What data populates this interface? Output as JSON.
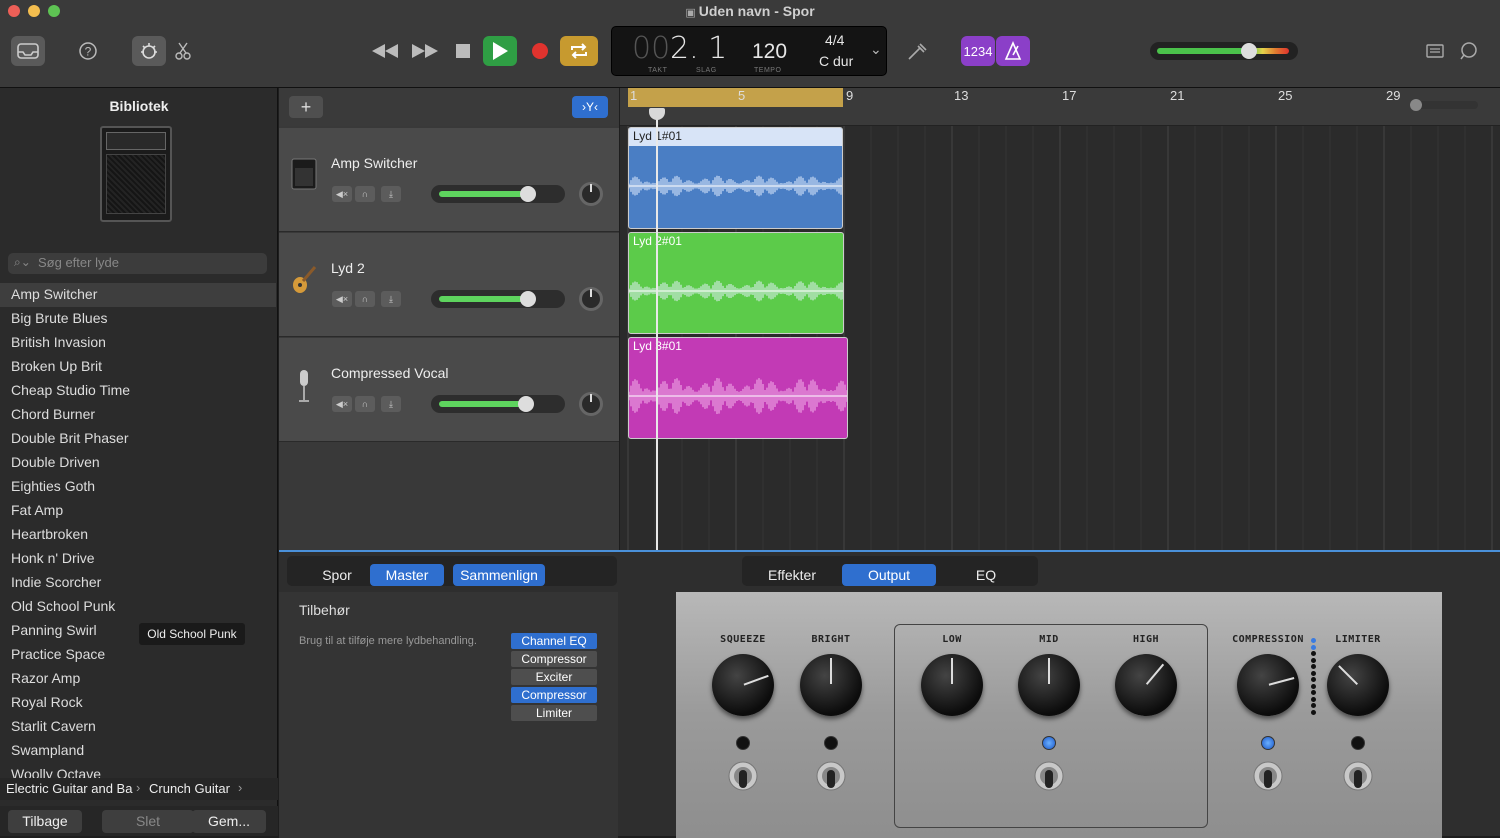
{
  "window": {
    "title": "Uden navn - Spor"
  },
  "lcd": {
    "bar_prefix": "00",
    "position": "2. 1",
    "takt_label": "TAKT",
    "slag_label": "SLAG",
    "tempo": "120",
    "tempo_label": "TEMPO",
    "signature": "4/4",
    "key": "C dur"
  },
  "count_in": "1234",
  "library": {
    "title": "Bibliotek",
    "search_placeholder": "Søg efter lyde",
    "items": [
      "Amp Switcher",
      "Big Brute Blues",
      "British Invasion",
      "Broken Up Brit",
      "Cheap Studio Time",
      "Chord Burner",
      "Double Brit Phaser",
      "Double Driven",
      "Eighties Goth",
      "Fat Amp",
      "Heartbroken",
      "Honk n' Drive",
      "Indie Scorcher",
      "Old School Punk",
      "Panning Swirl",
      "Practice Space",
      "Razor Amp",
      "Royal Rock",
      "Starlit Cavern",
      "Swampland",
      "Woolly Octave"
    ],
    "selected": "Amp Switcher",
    "tooltip": "Old School Punk",
    "breadcrumb": [
      "Electric Guitar and Ba",
      "Crunch Guitar"
    ],
    "buttons": {
      "back": "Tilbage",
      "delete": "Slet",
      "save": "Gem..."
    }
  },
  "tracks": [
    {
      "name": "Amp Switcher",
      "region": "Lyd 1#01",
      "color": "#4a7ec4",
      "volume": 0.78
    },
    {
      "name": "Lyd 2",
      "region": "Lyd 2#01",
      "color": "#5ccb4a",
      "volume": 0.78
    },
    {
      "name": "Compressed Vocal",
      "region": "Lyd 3#01",
      "color": "#c23ab5",
      "volume": 0.76
    }
  ],
  "ruler": {
    "bars": [
      "1",
      "5",
      "9",
      "13",
      "17",
      "21",
      "25",
      "29"
    ]
  },
  "smart_controls": {
    "left_tabs": [
      "Spor",
      "Master",
      "Sammenlign"
    ],
    "right_tabs": [
      "Effekter",
      "Output",
      "EQ"
    ],
    "active_right_tab": "Output",
    "section_title": "Tilbehør",
    "hint": "Brug til at tilføje mere lydbehandling.",
    "plugins": [
      {
        "name": "Channel EQ",
        "active": true
      },
      {
        "name": "Compressor",
        "active": false
      },
      {
        "name": "Exciter",
        "active": false
      },
      {
        "name": "Compressor",
        "active": true
      },
      {
        "name": "Limiter",
        "active": false
      }
    ],
    "knobs": [
      "SQUEEZE",
      "BRIGHT",
      "LOW",
      "MID",
      "HIGH",
      "COMPRESSION",
      "LIMITER"
    ]
  },
  "colors": {
    "accent": "#2f6fcf",
    "play": "#2f9e44",
    "record": "#e0332e",
    "cycle": "#c79a2f",
    "count_in": "#8b3fc8"
  }
}
